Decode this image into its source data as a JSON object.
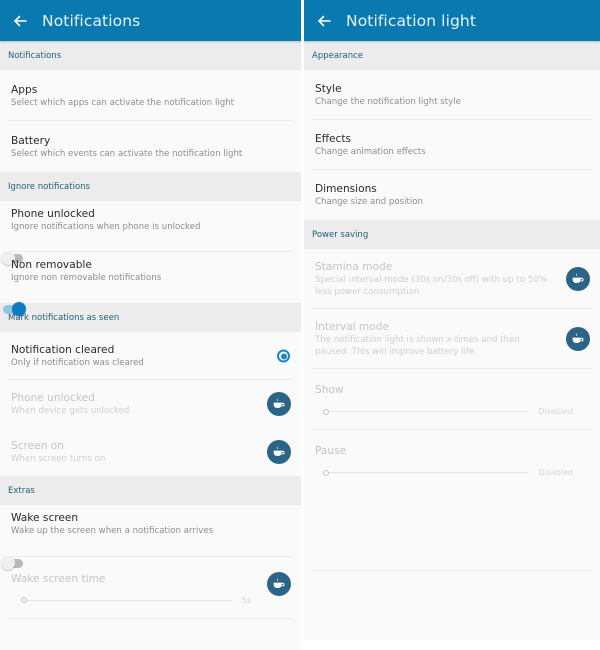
{
  "left": {
    "title": "Notifications",
    "sections": [
      {
        "header": "Notifications",
        "items": [
          {
            "title": "Apps",
            "summary": "Select which apps can activate the notification light"
          },
          {
            "title": "Battery",
            "summary": "Select which events can activate the notification light"
          }
        ]
      },
      {
        "header": "Ignore notifications",
        "items": [
          {
            "title": "Phone unlocked",
            "summary": "Ignore notifications when phone is unlocked",
            "control": "switch",
            "checked": false
          },
          {
            "title": "Non removable",
            "summary": "Ignore non removable notifications",
            "control": "switch",
            "checked": true
          }
        ]
      },
      {
        "header": "Mark notifications as seen",
        "items": [
          {
            "title": "Notification cleared",
            "summary": "Only if notification was cleared",
            "control": "radio",
            "checked": true
          },
          {
            "title": "Phone unlocked",
            "summary": "When device gets unlocked",
            "control": "coffee-icon",
            "disabled": true
          },
          {
            "title": "Screen on",
            "summary": "When screen turns on",
            "control": "coffee-icon",
            "disabled": true
          }
        ]
      },
      {
        "header": "Extras",
        "items": [
          {
            "title": "Wake screen",
            "summary": "Wake up the screen when a notification arrives",
            "control": "switch",
            "checked": false
          },
          {
            "title": "Wake screen time",
            "control": "slider",
            "value_label": "5s",
            "value_fraction": 0,
            "disabled": true,
            "badge": "coffee-icon"
          }
        ]
      }
    ]
  },
  "right": {
    "title": "Notification light",
    "sections": [
      {
        "header": "Appearance",
        "items": [
          {
            "title": "Style",
            "summary": "Change the notification light style"
          },
          {
            "title": "Effects",
            "summary": "Change animation effects"
          },
          {
            "title": "Dimensions",
            "summary": "Change size and position"
          }
        ]
      },
      {
        "header": "Power saving",
        "items": [
          {
            "title": "Stamina mode",
            "summary": "Special interval mode (30s on/30s off) with up to 50% less power consumption",
            "control": "coffee-icon",
            "disabled": true
          },
          {
            "title": "Interval mode",
            "summary": "The notification light is shown x-times and then paused. This will improve battery life.",
            "control": "coffee-icon",
            "disabled": true
          },
          {
            "title": "Show",
            "control": "slider",
            "value_label": "Disabled",
            "value_fraction": 0,
            "disabled": true
          },
          {
            "title": "Pause",
            "control": "slider",
            "value_label": "Disabled",
            "value_fraction": 0,
            "disabled": true
          }
        ]
      }
    ]
  },
  "colors": {
    "appbar": "#0a79b0",
    "accent": "#0c7cc0",
    "section_bg": "#ececec",
    "section_text": "#1f5e7a",
    "coffee_badge": "#2c6488"
  }
}
